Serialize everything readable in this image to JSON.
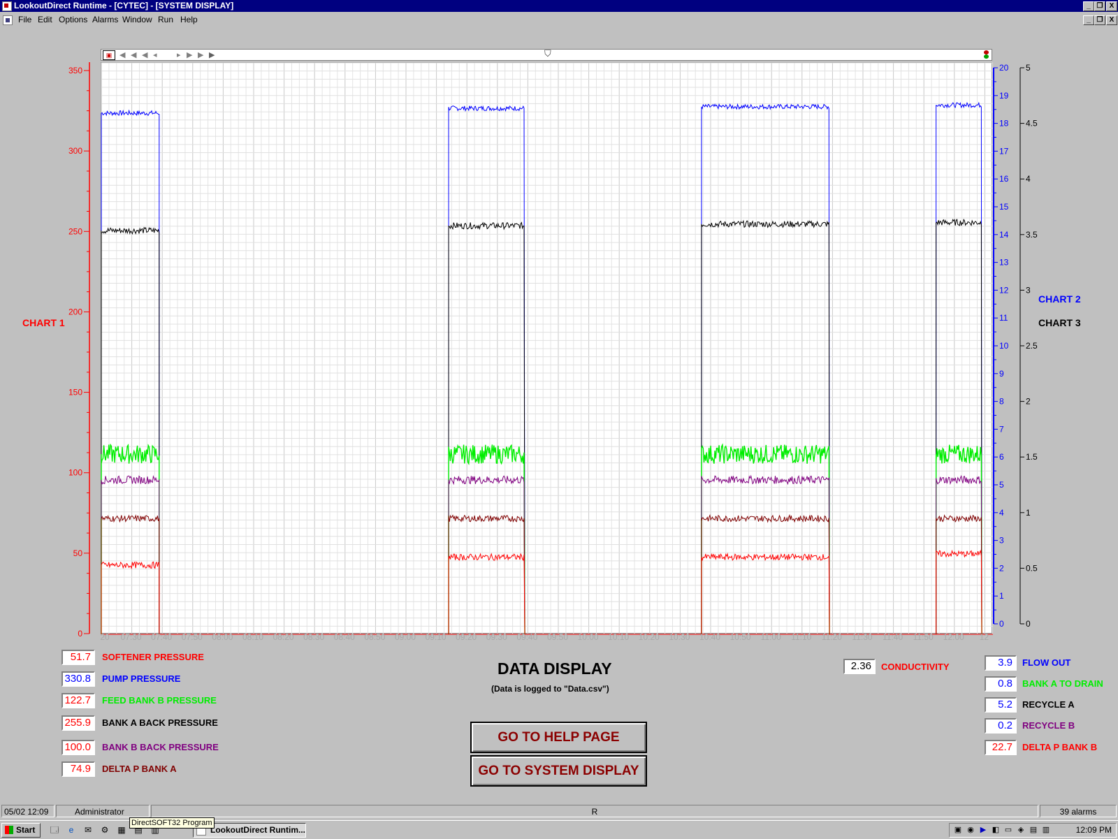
{
  "window": {
    "title": "LookoutDirect Runtime - [CYTEC] - [SYSTEM DISPLAY]",
    "minimize": "_",
    "restore": "❐",
    "close": "X"
  },
  "menu": [
    "File",
    "Edit",
    "Options",
    "Alarms",
    "Window",
    "Run",
    "Help"
  ],
  "chart_labels": {
    "chart1": "CHART 1",
    "chart2": "CHART 2",
    "chart3": "CHART 3"
  },
  "colors": {
    "softener": "#ff0000",
    "pump": "#0000ff",
    "feed_b": "#00ee00",
    "bank_a_back": "#000000",
    "bank_b_back": "#800080",
    "delta_p_a": "#800000",
    "axis_chart1": "#ff0000",
    "axis_chart2": "#0000ff",
    "axis_chart3": "#000000"
  },
  "chart_data": {
    "type": "line",
    "x_ticks": [
      "20",
      "07:30",
      "07:40",
      "07:50",
      "08:00",
      "08:10",
      "08:20",
      "08:30",
      "08:40",
      "08:50",
      "09:00",
      "09:10",
      "09:20",
      "09:30",
      "09:40",
      "09:50",
      "10:00",
      "10:10",
      "10:20",
      "10:30",
      "10:40",
      "10:50",
      "11:00",
      "11:10",
      "11:20",
      "11:30",
      "11:40",
      "11:50",
      "12:00",
      "12"
    ],
    "y_left": {
      "ticks": [
        "0",
        "50",
        "100",
        "150",
        "200",
        "250",
        "300",
        "350"
      ],
      "ylim": [
        0,
        350
      ]
    },
    "y_right_blue": {
      "ticks": [
        "0",
        "1",
        "2",
        "3",
        "4",
        "5",
        "6",
        "7",
        "8",
        "9",
        "10",
        "11",
        "12",
        "13",
        "14",
        "15",
        "16",
        "17",
        "18",
        "19",
        "20"
      ],
      "ylim": [
        0,
        20
      ]
    },
    "y_right_black": {
      "ticks": [
        "0",
        "0.5",
        "1",
        "1.5",
        "2",
        "2.5",
        "3",
        "3.5",
        "4",
        "4.5",
        "5"
      ],
      "ylim": [
        0,
        5
      ]
    },
    "run_periods": [
      [
        "07:20",
        "07:39"
      ],
      [
        "09:14",
        "09:39"
      ],
      [
        "10:37",
        "11:19"
      ],
      [
        "11:54",
        "12:09"
      ]
    ],
    "series": [
      {
        "key": "pump",
        "levels": [
          324,
          327,
          328,
          329
        ]
      },
      {
        "key": "bank_a_back",
        "levels": [
          251,
          254,
          255,
          256
        ]
      },
      {
        "key": "feed_b",
        "levels": [
          112,
          112,
          112,
          112
        ]
      },
      {
        "key": "bank_b_back",
        "levels": [
          96,
          96,
          96,
          96
        ]
      },
      {
        "key": "delta_p_a",
        "levels": [
          72,
          72,
          72,
          72
        ]
      },
      {
        "key": "softener",
        "levels": [
          43,
          48,
          48,
          50
        ]
      }
    ]
  },
  "left_readouts": [
    {
      "value": "51.7",
      "label": "SOFTENER PRESSURE",
      "color": "#ff0000"
    },
    {
      "value": "330.8",
      "label": "PUMP PRESSURE",
      "color": "#0000ff"
    },
    {
      "value": "122.7",
      "label": "FEED BANK B  PRESSURE",
      "color": "#00ee00"
    },
    {
      "value": "255.9",
      "label": "BANK A BACK  PRESSURE",
      "color": "#000000"
    },
    {
      "value": "100.0",
      "label": "BANK B BACK  PRESSURE",
      "color": "#800080"
    },
    {
      "value": "74.9",
      "label": "DELTA P  BANK A",
      "color": "#800000"
    }
  ],
  "center": {
    "title": "DATA DISPLAY",
    "subtitle": "(Data is logged to \"Data.csv\")",
    "help_button": "GO TO HELP PAGE",
    "system_button": "GO TO SYSTEM DISPLAY"
  },
  "conductivity": {
    "value": "2.36",
    "label": "CONDUCTIVITY"
  },
  "right_readouts": [
    {
      "value": "3.9",
      "label": "FLOW OUT",
      "color": "#0000ff"
    },
    {
      "value": "0.8",
      "label": "BANK A TO DRAIN",
      "color": "#00ee00"
    },
    {
      "value": "5.2",
      "label": "RECYCLE A",
      "color": "#000000"
    },
    {
      "value": "0.2",
      "label": "RECYCLE B",
      "color": "#800080"
    },
    {
      "value": "22.7",
      "label": "DELTA P BANK B",
      "color": "#ff0000"
    }
  ],
  "status": {
    "datetime": "05/02 12:09",
    "user": "Administrator",
    "mode": "R",
    "alarms": "39 alarms"
  },
  "taskbar": {
    "start": "Start",
    "task": "LookoutDirect Runtim...",
    "tooltip": "DirectSOFT32 Program",
    "clock": "12:09 PM"
  }
}
